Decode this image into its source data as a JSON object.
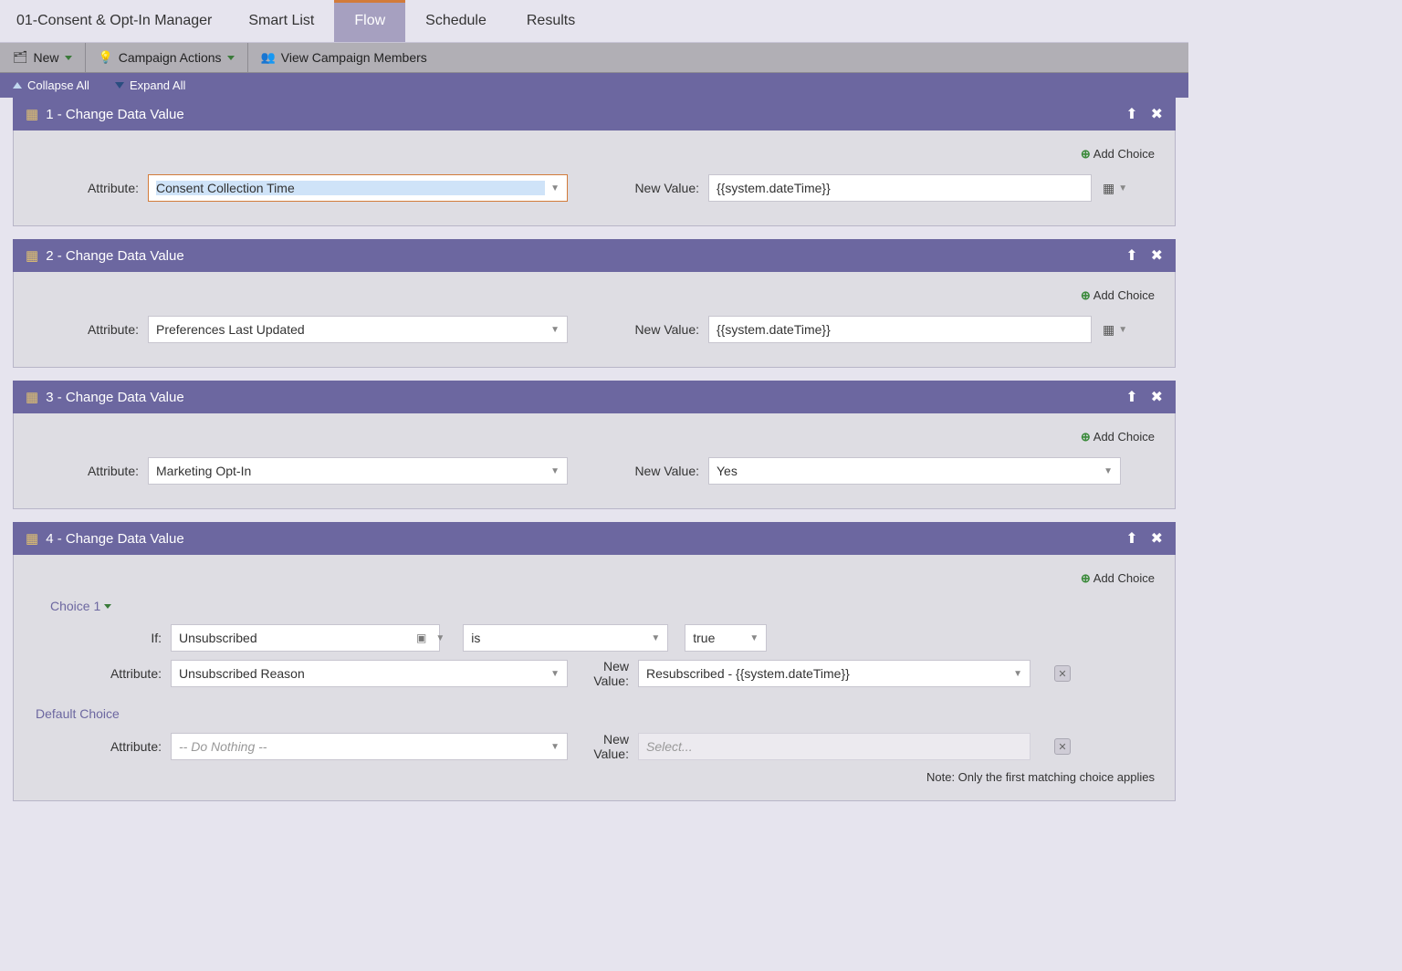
{
  "page": {
    "title": "01-Consent & Opt-In Manager",
    "tabs": [
      "Smart List",
      "Flow",
      "Schedule",
      "Results"
    ],
    "active_tab": "Flow"
  },
  "toolbar": {
    "new": "New",
    "campaign_actions": "Campaign Actions",
    "view_members": "View Campaign Members"
  },
  "collapsebar": {
    "collapse_all": "Collapse All",
    "expand_all": "Expand All"
  },
  "labels": {
    "attribute": "Attribute:",
    "new_value": "New Value:",
    "add_choice": "Add Choice",
    "if": "If:"
  },
  "steps": [
    {
      "title": "1 - Change Data Value",
      "attribute": "Consent Collection Time",
      "new_value": "{{system.dateTime}}",
      "attr_active": true,
      "has_calendar": true
    },
    {
      "title": "2 - Change Data Value",
      "attribute": "Preferences Last Updated",
      "new_value": "{{system.dateTime}}",
      "has_calendar": true
    },
    {
      "title": "3 - Change Data Value",
      "attribute": "Marketing Opt-In",
      "new_value": "Yes",
      "has_calendar": false
    }
  ],
  "step4": {
    "title": "4 - Change Data Value",
    "choice_label": "Choice 1",
    "if_field": "Unsubscribed",
    "if_op": "is",
    "if_val": "true",
    "attribute": "Unsubscribed Reason",
    "new_value": "Resubscribed - {{system.dateTime}}",
    "default_label": "Default Choice",
    "default_attribute": "-- Do Nothing --",
    "default_nv_placeholder": "Select...",
    "note": "Note: Only the first matching choice applies"
  }
}
